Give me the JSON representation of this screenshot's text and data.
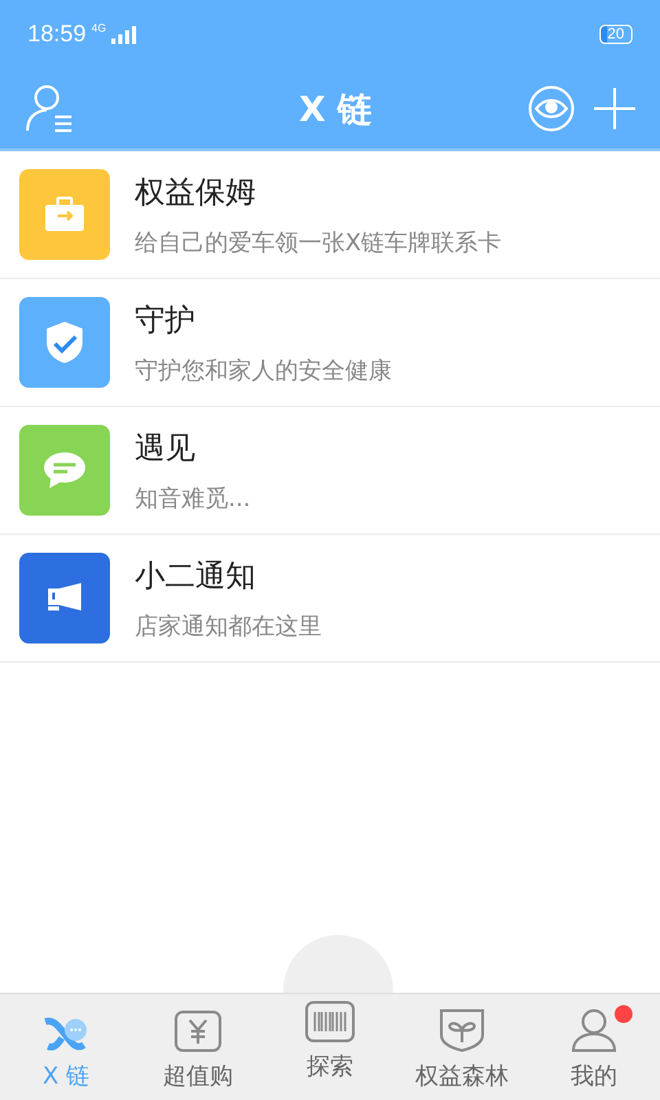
{
  "status_bar": {
    "time": "18:59",
    "network": "4G",
    "battery": "20"
  },
  "header": {
    "title": "X 链"
  },
  "items": [
    {
      "kind": "briefcase",
      "color": "#fdc63c",
      "title": "权益保姆",
      "subtitle": "给自己的爱车领一张X链车牌联系卡"
    },
    {
      "kind": "shield",
      "color": "#5cb0fc",
      "title": "守护",
      "subtitle": "守护您和家人的安全健康"
    },
    {
      "kind": "chat",
      "color": "#88d455",
      "title": "遇见",
      "subtitle": "知音难觅..."
    },
    {
      "kind": "megaphone",
      "color": "#2d6fe0",
      "title": "小二通知",
      "subtitle": "店家通知都在这里"
    }
  ],
  "tabs": [
    {
      "kind": "logo",
      "label": "X 链",
      "selected": true,
      "badge": false
    },
    {
      "kind": "yuan",
      "label": "超值购",
      "selected": false,
      "badge": false
    },
    {
      "kind": "barcode",
      "label": "探索",
      "selected": false,
      "badge": false
    },
    {
      "kind": "sprout",
      "label": "权益森林",
      "selected": false,
      "badge": false
    },
    {
      "kind": "person",
      "label": "我的",
      "selected": false,
      "badge": true
    }
  ]
}
